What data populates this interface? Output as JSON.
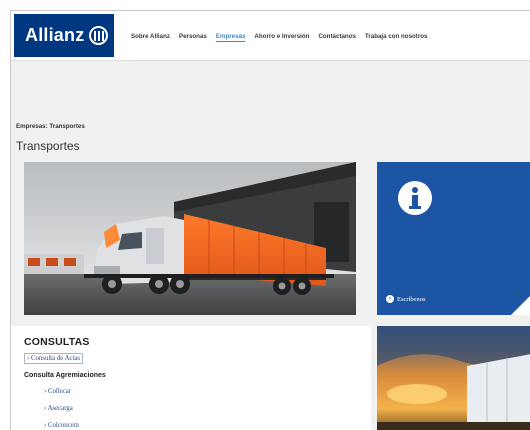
{
  "brand": {
    "name": "Allianz",
    "color": "#003781"
  },
  "nav": {
    "items": [
      {
        "label": "Sobre Allianz",
        "active": false
      },
      {
        "label": "Personas",
        "active": false
      },
      {
        "label": "Empresas",
        "active": true
      },
      {
        "label": "Ahorro e Inversión",
        "active": false
      },
      {
        "label": "Contáctanos",
        "active": false
      },
      {
        "label": "Trabaja con nosotros",
        "active": false
      }
    ]
  },
  "breadcrumb": "Empresas: Transportes",
  "page_title": "Transportes",
  "info_card": {
    "icon": "info-icon",
    "link_icon": "chevron-right-icon",
    "link_label": "Escríbenos",
    "color": "#1b55a3"
  },
  "consultas": {
    "title": "CONSULTAS",
    "link_actas": "› Consulta de Actas",
    "subtitle": "Consulta Agremiaciones",
    "items": [
      "› Collecar",
      "› Asecarga",
      "› Colconcem"
    ]
  }
}
